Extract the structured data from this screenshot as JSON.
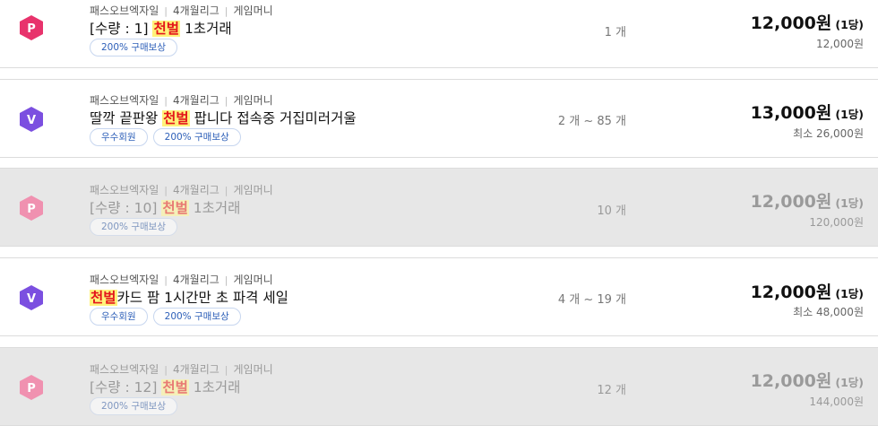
{
  "colors": {
    "p_icon": "#e8336c",
    "p_icon_disabled": "#f091b0",
    "v_icon": "#7b4fe0",
    "highlight_bg": "#fff27a",
    "highlight_text": "#e4161b",
    "badge_text": "#2d5fb8"
  },
  "listings": [
    {
      "icon": "P",
      "icon_name": "power-seller-p-icon",
      "meta": [
        "패스오브엑자일",
        "4개월리그",
        "게임머니"
      ],
      "title_before": "[수량 : 1] ",
      "title_highlight": "천벌",
      "title_after": " 1초거래",
      "badges": [
        "200% 구매보상"
      ],
      "qty": "1 개",
      "price": "12,000원",
      "unit": "(1당)",
      "sub": "12,000원",
      "disabled": false
    },
    {
      "icon": "V",
      "icon_name": "vip-seller-v-icon",
      "meta": [
        "패스오브엑자일",
        "4개월리그",
        "게임머니"
      ],
      "title_before": "딸깍 끝판왕 ",
      "title_highlight": "천벌",
      "title_after": " 팝니다 접속중 거집미러거울",
      "badges": [
        "우수회원",
        "200% 구매보상"
      ],
      "qty": "2 개 ~ 85 개",
      "price": "13,000원",
      "unit": "(1당)",
      "sub": "최소 26,000원",
      "disabled": false
    },
    {
      "icon": "P",
      "icon_name": "power-seller-p-icon",
      "meta": [
        "패스오브엑자일",
        "4개월리그",
        "게임머니"
      ],
      "title_before": "[수량 : 10] ",
      "title_highlight": "천벌",
      "title_after": " 1초거래",
      "badges": [
        "200% 구매보상"
      ],
      "qty": "10 개",
      "price": "12,000원",
      "unit": "(1당)",
      "sub": "120,000원",
      "disabled": true
    },
    {
      "icon": "V",
      "icon_name": "vip-seller-v-icon",
      "meta": [
        "패스오브엑자일",
        "4개월리그",
        "게임머니"
      ],
      "title_before": "",
      "title_highlight": "천벌",
      "title_after": "카드 팜 1시간만 초 파격 세일",
      "badges": [
        "우수회원",
        "200% 구매보상"
      ],
      "qty": "4 개 ~ 19 개",
      "price": "12,000원",
      "unit": "(1당)",
      "sub": "최소 48,000원",
      "disabled": false
    },
    {
      "icon": "P",
      "icon_name": "power-seller-p-icon",
      "meta": [
        "패스오브엑자일",
        "4개월리그",
        "게임머니"
      ],
      "title_before": "[수량 : 12] ",
      "title_highlight": "천벌",
      "title_after": " 1초거래",
      "badges": [
        "200% 구매보상"
      ],
      "qty": "12 개",
      "price": "12,000원",
      "unit": "(1당)",
      "sub": "144,000원",
      "disabled": true
    }
  ]
}
